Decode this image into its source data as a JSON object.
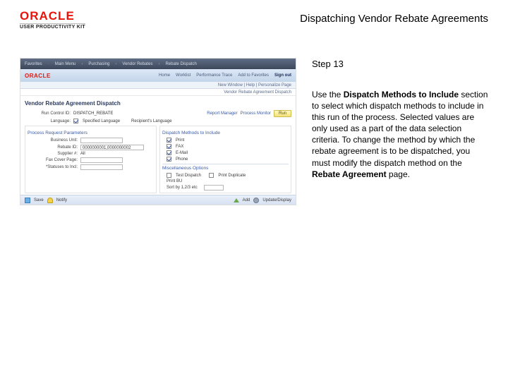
{
  "header": {
    "brand": "ORACLE",
    "brand_sub": "USER PRODUCTIVITY KIT",
    "page_title": "Dispatching Vendor Rebate Agreements"
  },
  "right": {
    "step_label": "Step 13",
    "instr_pre": "Use the ",
    "instr_bold1": "Dispatch Methods to Include",
    "instr_mid": " section to select which dispatch methods to include in this run of the process. Selected values are only used as a part of the data selection criteria. To change the method by which the rebate agreement is to be dispatched, you must modify the dispatch method on the ",
    "instr_bold2": "Rebate Agreement",
    "instr_post": " page."
  },
  "shot": {
    "top": {
      "a": "Favorites",
      "b": "Main Menu",
      "c": "Purchasing",
      "d": "Vendor Rebates",
      "e": "Rebate Dispatch"
    },
    "brand_mini": "ORACLE",
    "tabs": [
      "Home",
      "Worklist",
      "Performance Trace",
      "Add to Favorites",
      "Sign out"
    ],
    "userline": "New Window | Help | Personalize Page",
    "crumb": "Vendor Rebate Agreement Dispatch",
    "page_section_title": "Vendor Rebate Agreement Dispatch",
    "runcontrol_row": {
      "lbl": "Run Control ID:",
      "val": "DISPATCH_REBATE",
      "rm": "Report Manager",
      "pm": "Process Monitor",
      "run": "Run"
    },
    "lang_row": {
      "lbl": "Language:",
      "opt": "Specified Language",
      "lang_lbl": "Recipient's Language"
    },
    "sections": {
      "left_title": "Process Request Parameters",
      "mid_title": "Dispatch Methods to Include",
      "right_title": "Miscellaneous Options"
    },
    "left_fields": [
      {
        "lbl": "Business Unit:",
        "val": ""
      },
      {
        "lbl": "Rebate ID:",
        "val": "0000000001,0000000002"
      },
      {
        "lbl": "Supplier #:",
        "val": "All"
      },
      {
        "lbl": "Fax Cover Page:",
        "val": ""
      },
      {
        "lbl": "*Statuses to Incl:",
        "val": ""
      }
    ],
    "mid_fields": [
      {
        "lbl": "Print",
        "checked": true
      },
      {
        "lbl": "FAX",
        "checked": true
      },
      {
        "lbl": "E-Mail",
        "checked": true
      },
      {
        "lbl": "Phone",
        "checked": true
      }
    ],
    "right_fields": [
      {
        "lbl": "Test Dispatch",
        "checked": false
      },
      {
        "lbl": "Print Duplicate",
        "checked": false
      },
      {
        "lbl": "Print BU",
        "type": "text"
      },
      {
        "lbl": "Sort by 1,2/3 etc",
        "type": "input"
      }
    ],
    "footer": {
      "save": "Save",
      "notify": "Notify",
      "add": "Add",
      "upd": "Update/Display"
    }
  }
}
